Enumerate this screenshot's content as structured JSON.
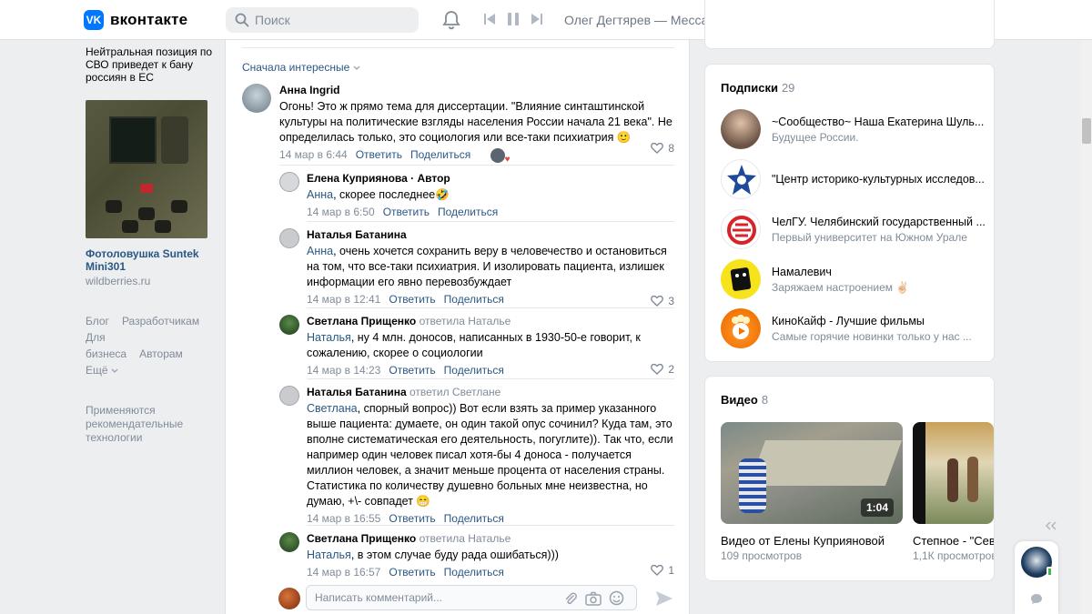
{
  "header": {
    "logo_text": "вконтакте",
    "logo_mark": "VK",
    "search_placeholder": "Поиск",
    "now_playing": "Олег Дегтярев — Месса за упокой",
    "accent": "#0077ff"
  },
  "left": {
    "ad_text": "Нейтральная позиция по СВО приведет к бану россиян в ЕС",
    "ad_product_title": "Фотоловушка Suntek Mini301",
    "ad_product_source": "wildberries.ru",
    "links": [
      "Блог",
      "Разработчикам",
      "Для бизнеса",
      "Авторам"
    ],
    "more": "Ещё",
    "tech_note": "Применяются рекомендательные технологии"
  },
  "comments": {
    "sort_label": "Сначала интересные",
    "items": [
      {
        "author": "Анна Ingrid",
        "reply_note": "",
        "addressee": "",
        "text": "Огонь! Это ж прямо тема для диссертации. \"Влияние синташтинской культуры на политические взгляды населения России начала 21 века\". Не определилась только, это социология или все-таки психиатрия 🙂",
        "time": "14 мар в 6:44",
        "reply": "Ответить",
        "share": "Поделиться",
        "likes": "8"
      },
      {
        "author": "Елена Куприянова · Автор",
        "reply_note": "",
        "addressee": "Анна",
        "text": ", скорее последнее🤣",
        "time": "14 мар в 6:50",
        "reply": "Ответить",
        "share": "Поделиться",
        "likes": ""
      },
      {
        "author": "Наталья Батанина",
        "reply_note": "",
        "addressee": "Анна",
        "text": ", очень хочется сохранить веру в человечество и остановиться на том, что все-таки психиатрия. И изолировать пациента, излишек информации его явно перевозбуждает",
        "time": "14 мар в 12:41",
        "reply": "Ответить",
        "share": "Поделиться",
        "likes": "3"
      },
      {
        "author": "Светлана Прищенко",
        "reply_note": "ответила Наталье",
        "addressee": "Наталья",
        "text": ", ну 4 млн. доносов, написанных в 1930-50-е говорит, к сожалению, скорее о социологии",
        "time": "14 мар в 14:23",
        "reply": "Ответить",
        "share": "Поделиться",
        "likes": "2"
      },
      {
        "author": "Наталья Батанина",
        "reply_note": "ответил Светлане",
        "addressee": "Светлана",
        "text": ", спорный вопрос)) Вот если взять за пример указанного выше пациента: думаете, он один такой опус сочинил? Куда там, это вполне систематическая его деятельность, погуглите)). Так что, если например один человек писал хотя-бы 4 доноса - получается миллион человек, а значит меньше процента от населения страны. Статистика по количеству душевно больных мне неизвестна, но думаю, +\\- совпадет 😁",
        "time": "14 мар в 16:55",
        "reply": "Ответить",
        "share": "Поделиться",
        "likes": ""
      },
      {
        "author": "Светлана Прищенко",
        "reply_note": "ответила Наталье",
        "addressee": "Наталья",
        "text": ", в этом случае буду рада ошибаться)))",
        "time": "14 мар в 16:57",
        "reply": "Ответить",
        "share": "Поделиться",
        "likes": "1"
      }
    ],
    "compose_placeholder": "Написать комментарий..."
  },
  "subscriptions": {
    "title": "Подписки",
    "count": "29",
    "items": [
      {
        "name": "~Сообщество~ Наша Екатерина Шуль...",
        "desc": "Будущее России."
      },
      {
        "name": "\"Центр историко-культурных исследов...",
        "desc": ""
      },
      {
        "name": "ЧелГУ. Челябинский государственный ...",
        "desc": "Первый университет на Южном Урале"
      },
      {
        "name": "Намалевич",
        "desc": "Заряжаем настроением ✌🏻"
      },
      {
        "name": "КиноКайф - Лучшие фильмы",
        "desc": "Самые горячие новинки только у нас ..."
      }
    ]
  },
  "videos": {
    "title": "Видео",
    "count": "8",
    "items": [
      {
        "title": "Видео от Елены Куприяновой",
        "views": "109 просмотров",
        "duration": "1:04"
      },
      {
        "title": "Степное - \"Севе",
        "views": "1,1К просмотров",
        "duration": ""
      }
    ]
  }
}
